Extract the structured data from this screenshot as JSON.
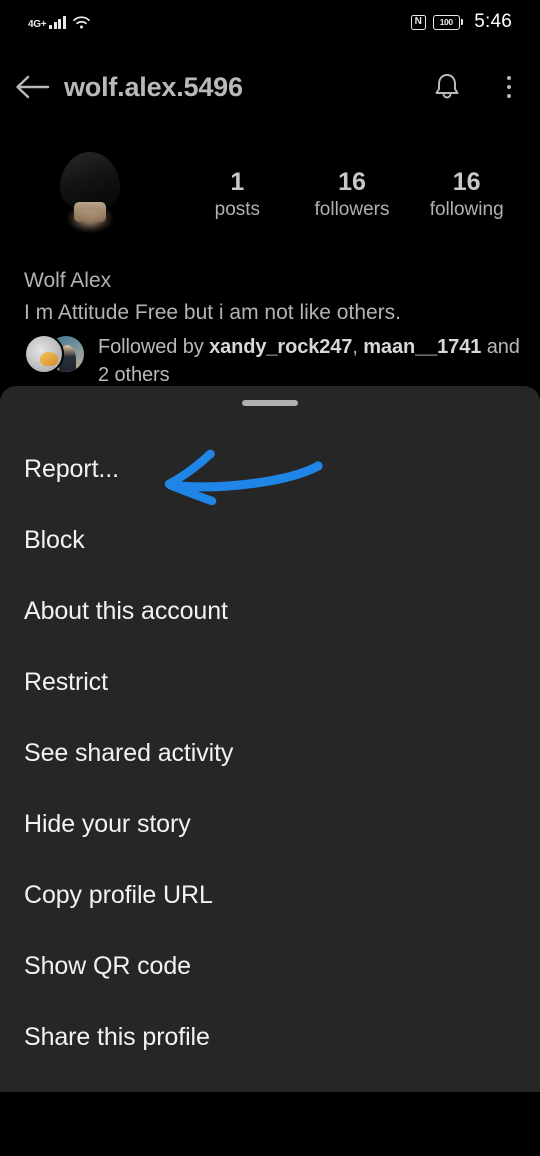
{
  "status_bar": {
    "network_type": "4G+",
    "signal_icon": "signal-bars-icon",
    "wifi_icon": "wifi-icon",
    "nfc_icon": "nfc-icon",
    "nfc_label": "N",
    "battery_level": "100",
    "battery_icon": "battery-full-icon",
    "time": "5:46"
  },
  "header": {
    "back_icon": "back-arrow-icon",
    "username": "wolf.alex.5496",
    "notification_icon": "bell-icon",
    "overflow_icon": "three-dots-vertical-icon"
  },
  "profile": {
    "avatar_icon": "profile-avatar-hooded-figure",
    "stats": [
      {
        "value": "1",
        "label": "posts"
      },
      {
        "value": "16",
        "label": "followers"
      },
      {
        "value": "16",
        "label": "following"
      }
    ],
    "full_name": "Wolf Alex",
    "bio": "I m Attitude Free but i am not like others.",
    "followed_by": {
      "prefix": "Followed by ",
      "user_1": "xandy_rock247",
      "separator": ", ",
      "user_2": "maan__1741",
      "suffix": " and 2 others",
      "avatar_1_icon": "follower-avatar-1",
      "avatar_2_icon": "follower-avatar-2"
    }
  },
  "bottom_sheet": {
    "handle_icon": "drag-handle",
    "items": [
      {
        "label": "Report..."
      },
      {
        "label": "Block"
      },
      {
        "label": "About this account"
      },
      {
        "label": "Restrict"
      },
      {
        "label": "See shared activity"
      },
      {
        "label": "Hide your story"
      },
      {
        "label": "Copy profile URL"
      },
      {
        "label": "Show QR code"
      },
      {
        "label": "Share this profile"
      }
    ]
  },
  "annotation": {
    "type": "hand-drawn-arrow",
    "direction": "left",
    "color": "#1f86e8",
    "points_to": "Report..."
  },
  "colors": {
    "page_background": "#000000",
    "sheet_background": "#262626",
    "primary_text": "#f2f2f2",
    "secondary_text": "#b3b3b3",
    "annotation_blue": "#1f86e8"
  }
}
